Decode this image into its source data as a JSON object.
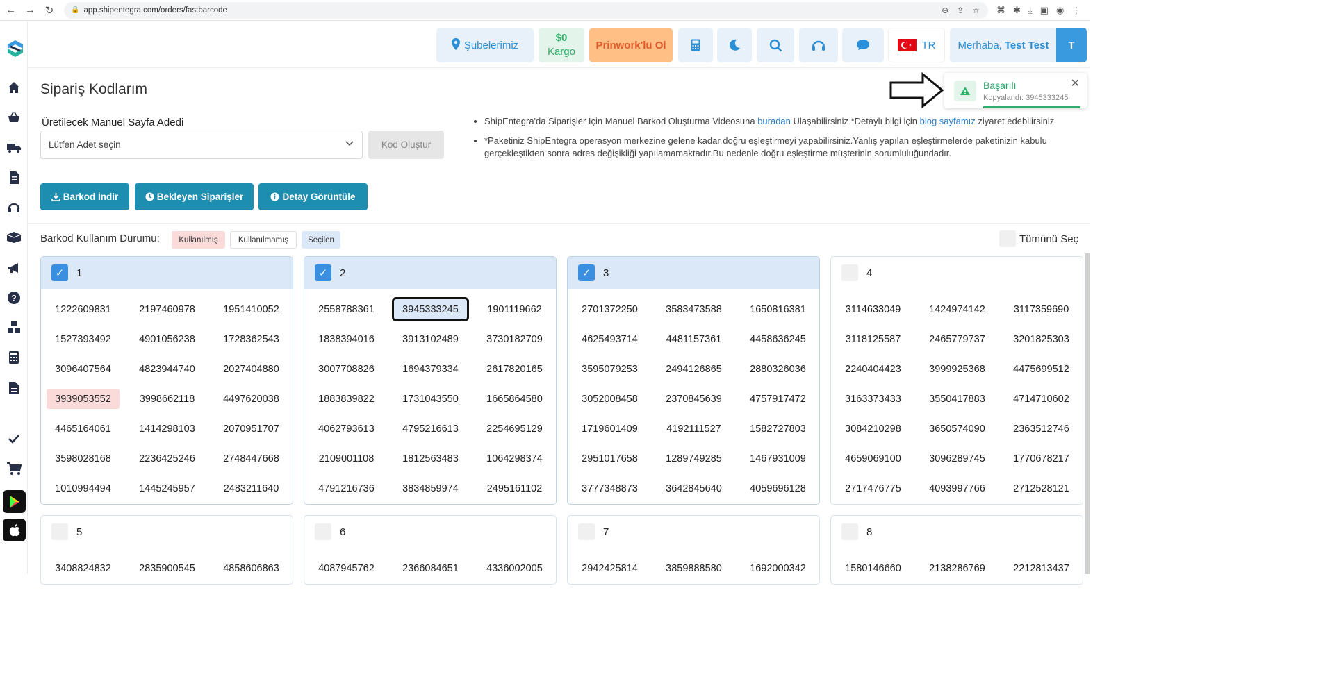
{
  "browser": {
    "url": "app.shipentegra.com/orders/fastbarcode"
  },
  "topbar": {
    "subeler": "Şubelerimiz",
    "balance_amount": "$0",
    "balance_label": "Kargo",
    "prinwork": "Prinwork'lü Ol",
    "lang": "TR",
    "greeting": "Merhaba,",
    "user_name": "Test Test",
    "avatar_letter": "T"
  },
  "page": {
    "title": "Sipariş Kodlarım"
  },
  "toast": {
    "title": "Başarılı",
    "message": "Kopyalandı: 3945333245"
  },
  "form": {
    "label": "Üretilecek Manuel Sayfa Adedi",
    "select_value": "Lütfen Adet seçin",
    "generate_button": "Kod Oluştur"
  },
  "info": {
    "line1_a": "ShipEntegra'da Siparişler İçin Manuel Barkod Oluşturma Videosuna ",
    "line1_link1": "buradan",
    "line1_b": " Ulaşabilirsiniz *Detaylı bilgi için ",
    "line1_link2": "blog sayfamız",
    "line1_c": " ziyaret edebilirsiniz",
    "line2": "*Paketiniz ShipEntegra operasyon merkezine gelene kadar doğru eşleştirmeyi yapabilirsiniz.Yanlış yapılan eşleştirmelerde paketinizin kabulu gerçekleştikten sonra adres değişikliği yapılamamaktadır.Bu nedenle doğru eşleştirme müşterinin sorumluluğundadır."
  },
  "actions": {
    "download": "Barkod İndir",
    "pending": "Bekleyen Siparişler",
    "details": "Detay Görüntüle"
  },
  "usage": {
    "label": "Barkod Kullanım Durumu:",
    "used": "Kullanılmış",
    "unused": "Kullanılmamış",
    "selected": "Seçilen",
    "select_all": "Tümünü Seç"
  },
  "colors": {
    "primary_button": "#1d8eb0",
    "selected_card": "#dbe8f8",
    "used_code": "#fbdada",
    "checkbox_on": "#3a8fe0"
  },
  "pages": [
    {
      "number": "1",
      "checked": true,
      "codes": [
        "1222609831",
        "2197460978",
        "1951410052",
        "1527393492",
        "4901056238",
        "1728362543",
        "3096407564",
        "4823944740",
        "2027404880",
        "3939053552",
        "3998662118",
        "4497620038",
        "4465164061",
        "1414298103",
        "2070951707",
        "3598028168",
        "2236425246",
        "2748447668",
        "1010994494",
        "1445245957",
        "2483211640"
      ]
    },
    {
      "number": "2",
      "checked": true,
      "codes": [
        "2558788361",
        "3945333245",
        "1901119662",
        "1838394016",
        "3913102489",
        "3730182709",
        "3007708826",
        "1694379334",
        "2617820165",
        "1883839822",
        "1731043550",
        "1665864580",
        "4062793613",
        "4795216613",
        "2254695129",
        "2109001108",
        "1812563483",
        "1064298374",
        "4791216736",
        "3834859974",
        "2495161102"
      ]
    },
    {
      "number": "3",
      "checked": true,
      "codes": [
        "2701372250",
        "3583473588",
        "1650816381",
        "4625493714",
        "4481157361",
        "4458636245",
        "3595079253",
        "2494126865",
        "2880326036",
        "3052008458",
        "2370845639",
        "4757917472",
        "1719601409",
        "4192111527",
        "1582727803",
        "2951017658",
        "1289749285",
        "1467931009",
        "3777348873",
        "3642845640",
        "4059696128"
      ]
    },
    {
      "number": "4",
      "checked": false,
      "codes": [
        "3114633049",
        "1424974142",
        "3117359690",
        "3118125587",
        "2465779737",
        "3201825303",
        "2240404423",
        "3999925368",
        "4475699512",
        "3163373433",
        "3550417883",
        "4714710602",
        "3084210298",
        "3650574090",
        "2363512746",
        "4659069100",
        "3096289745",
        "1770678217",
        "2717476775",
        "4093997766",
        "2712528121"
      ]
    },
    {
      "number": "5",
      "checked": false,
      "codes": [
        "3408824832",
        "2835900545",
        "4858606863"
      ]
    },
    {
      "number": "6",
      "checked": false,
      "codes": [
        "4087945762",
        "2366084651",
        "4336002005"
      ]
    },
    {
      "number": "7",
      "checked": false,
      "codes": [
        "2942425814",
        "3859888580",
        "1692000342"
      ]
    },
    {
      "number": "8",
      "checked": false,
      "codes": [
        "1580146660",
        "2138286769",
        "2212813437"
      ]
    }
  ],
  "used_codes": [
    "3939053552"
  ],
  "copied_code": "3945333245"
}
